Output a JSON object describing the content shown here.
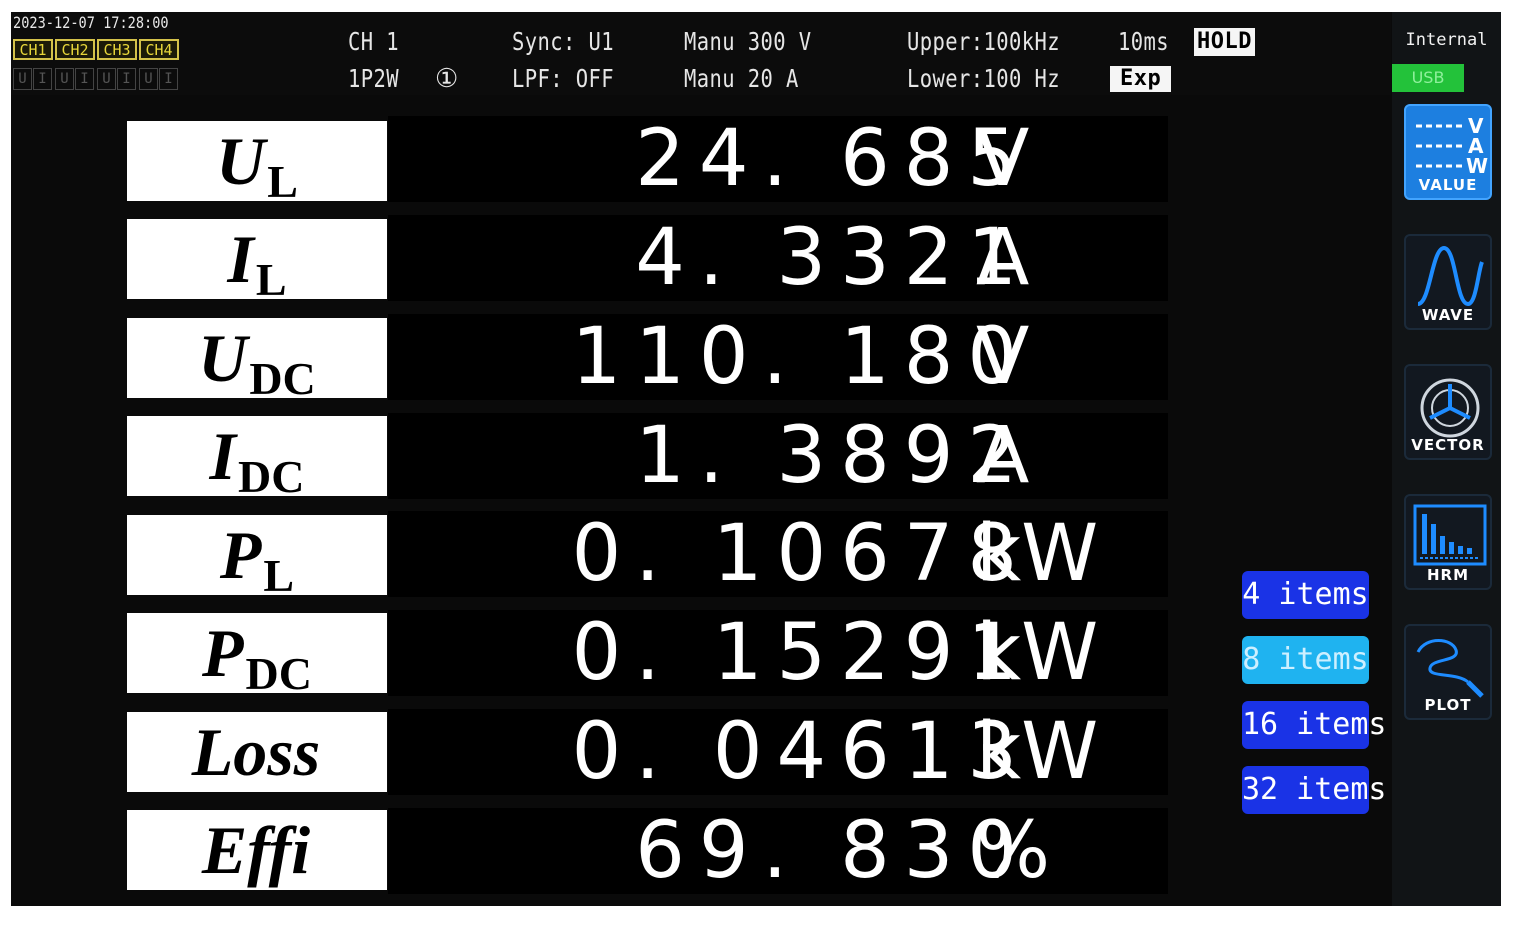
{
  "header": {
    "datetime": "2023-12-07 17:28:00",
    "channels": [
      "CH1",
      "CH2",
      "CH3",
      "CH4"
    ],
    "channel_modes": [
      "U",
      "I"
    ],
    "ch": "CH 1",
    "wiring": "1P2W",
    "wiring_mark": "①",
    "sync": "Sync: U1",
    "lpf": "LPF:  OFF",
    "voltage_range": "Manu 300 V",
    "current_range": "Manu  20 A",
    "upper_freq": "Upper:100kHz",
    "lower_freq": "Lower:100 Hz",
    "period": "10ms",
    "hold": "HOLD",
    "exp": "Exp"
  },
  "measurements": [
    {
      "label": "U",
      "sub": "L",
      "value": "24. 685",
      "unit": "V"
    },
    {
      "label": "I",
      "sub": "L",
      "value": "4. 3321",
      "unit": "A"
    },
    {
      "label": "U",
      "sub": "DC",
      "value": "110. 180",
      "unit": "V"
    },
    {
      "label": "I",
      "sub": "DC",
      "value": "1. 3892",
      "unit": "A"
    },
    {
      "label": "P",
      "sub": "L",
      "value": "0. 10678",
      "unit": "kW"
    },
    {
      "label": "P",
      "sub": "DC",
      "value": "0. 15291",
      "unit": "kW"
    },
    {
      "label": "Loss",
      "sub": "",
      "value": "0. 04613",
      "unit": "kW"
    },
    {
      "label": "Effi",
      "sub": "",
      "value": "69. 830",
      "unit": "%"
    }
  ],
  "item_buttons": [
    {
      "label": "4 items",
      "selected": false
    },
    {
      "label": "8 items",
      "selected": true
    },
    {
      "label": "16 items",
      "selected": false
    },
    {
      "label": "32 items",
      "selected": false
    }
  ],
  "sidebar": {
    "source": "Internal",
    "usb": "USB",
    "buttons": [
      {
        "label": "VALUE",
        "icon": "value-icon",
        "active": true
      },
      {
        "label": "WAVE",
        "icon": "wave-icon",
        "active": false
      },
      {
        "label": "VECTOR",
        "icon": "vector-icon",
        "active": false
      },
      {
        "label": "HRM",
        "icon": "hrm-icon",
        "active": false
      },
      {
        "label": "PLOT",
        "icon": "plot-icon",
        "active": false
      }
    ],
    "value_icon_letters": [
      "V",
      "A",
      "W"
    ]
  },
  "colors": {
    "item_selected": "#1fb3f0",
    "item_normal": "#1a33e6",
    "sidebar_active": "#1d7fe0",
    "channel_tab": "#e7d63a",
    "usb_bar": "#23c23a"
  }
}
